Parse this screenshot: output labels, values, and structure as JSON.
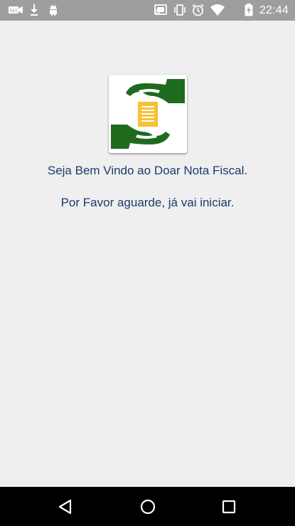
{
  "status_bar": {
    "time": "22:44",
    "background_color": "#9e9e9e",
    "left_icons": [
      "recorder-icon",
      "download-icon",
      "android-icon"
    ],
    "right_icons": [
      "cast-icon",
      "vibrate-icon",
      "alarm-icon",
      "wifi-icon",
      "battery-charging-icon"
    ]
  },
  "app": {
    "logo_icon": "hands-document-logo-icon",
    "welcome_message": "Seja Bem Vindo ao Doar Nota Fiscal.",
    "wait_message": "Por Favor aguarde, já vai iniciar.",
    "text_color": "#1a3b6c",
    "brand_green": "#1e6b1e",
    "document_color": "#f9c034"
  },
  "nav_bar": {
    "buttons": [
      "back-icon",
      "home-icon",
      "recents-icon"
    ]
  }
}
